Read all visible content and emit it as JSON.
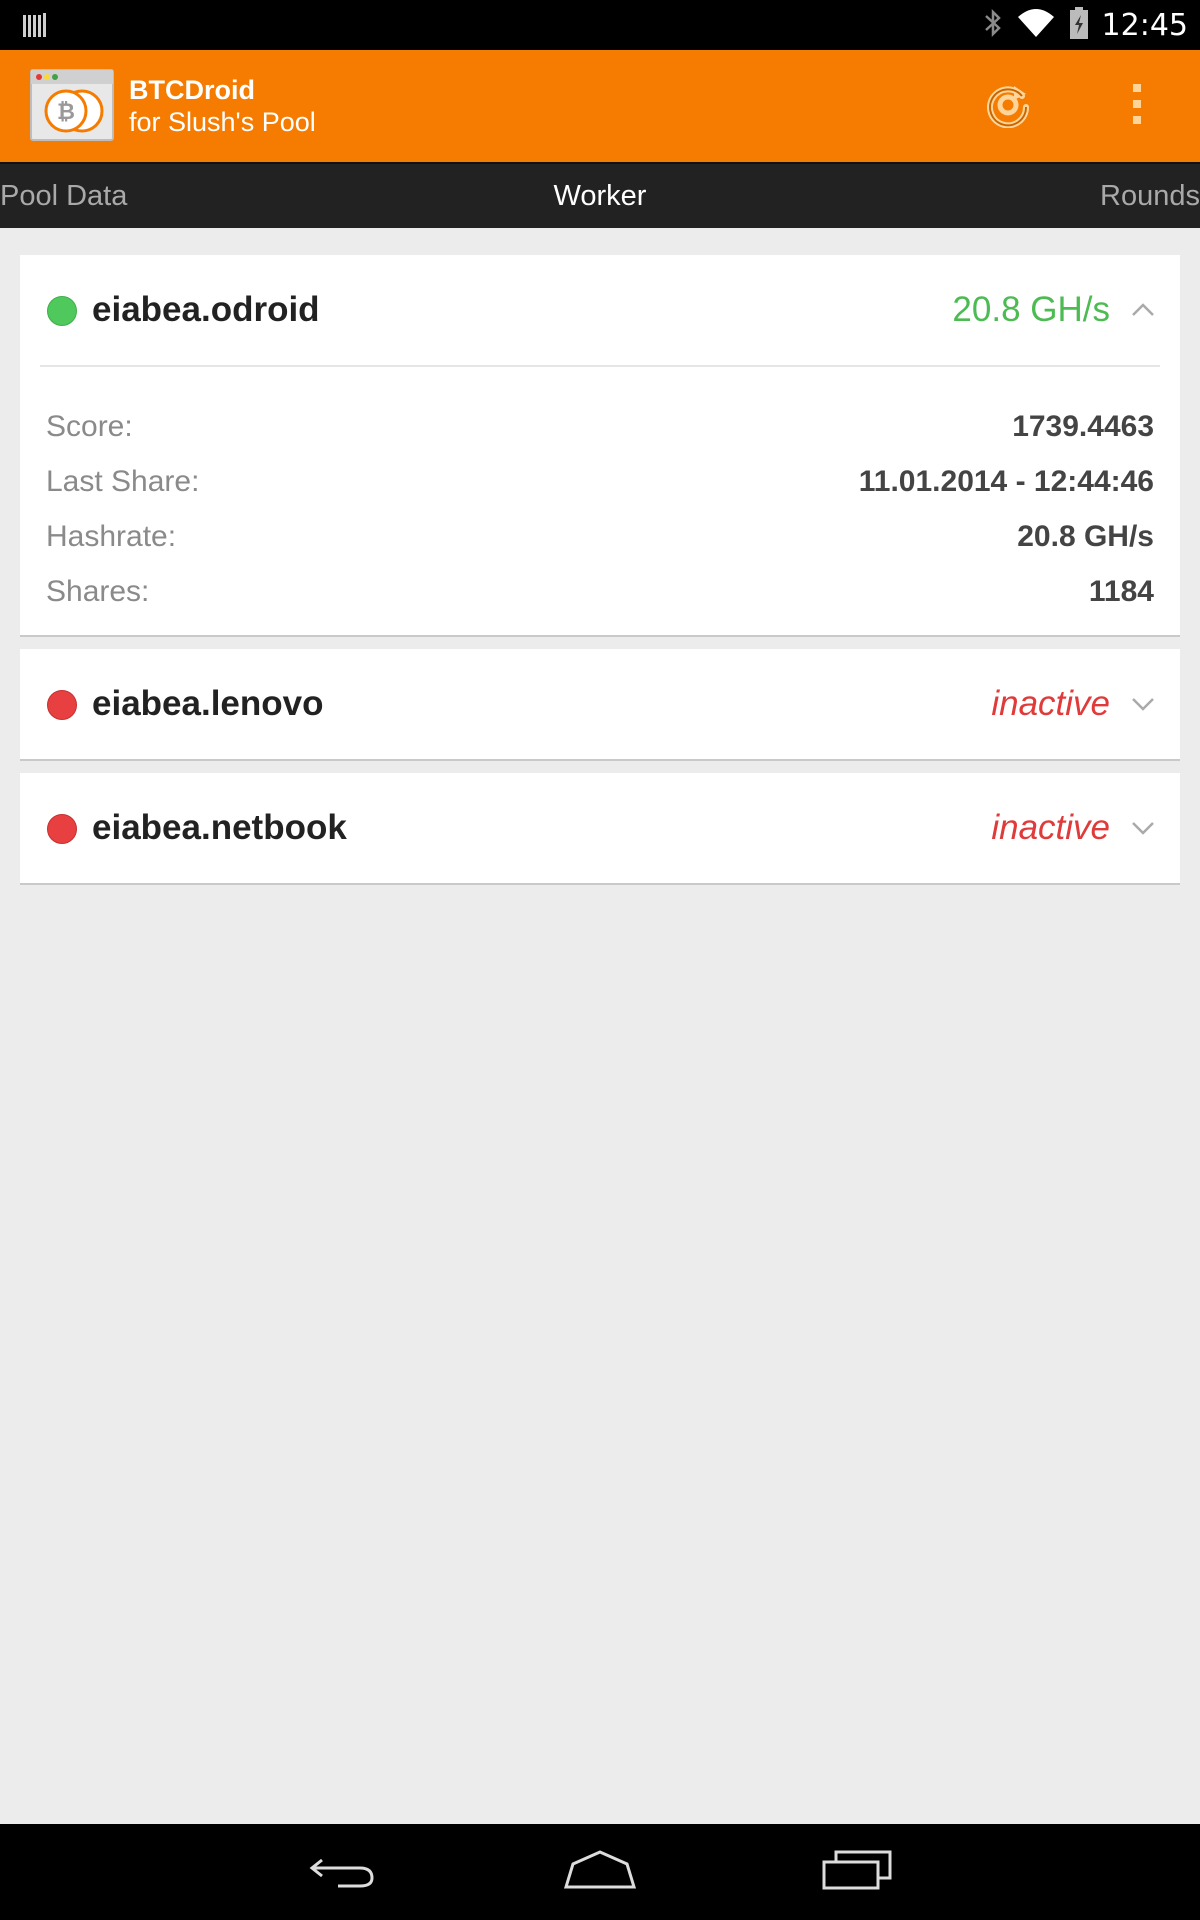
{
  "status_bar": {
    "time": "12:45",
    "icons": [
      "notification-icon",
      "bluetooth-icon",
      "wifi-icon",
      "battery-icon"
    ]
  },
  "app_bar": {
    "title": "BTCDroid",
    "subtitle": "for Slush's Pool",
    "background_color": "#f57c00",
    "actions": [
      "refresh-icon",
      "overflow-menu-icon"
    ]
  },
  "tabs": [
    {
      "label": "Pool Data",
      "active": false
    },
    {
      "label": "Worker",
      "active": true
    },
    {
      "label": "Rounds",
      "active": false
    }
  ],
  "workers": [
    {
      "name": "eiabea.odroid",
      "status": "active",
      "status_color": "#4fc95b",
      "rate_text": "20.8 GH/s",
      "expanded": true,
      "details": [
        {
          "label": "Score:",
          "value": "1739.4463"
        },
        {
          "label": "Last Share:",
          "value": "11.01.2014 - 12:44:46"
        },
        {
          "label": "Hashrate:",
          "value": "20.8 GH/s"
        },
        {
          "label": "Shares:",
          "value": "1184"
        }
      ]
    },
    {
      "name": "eiabea.lenovo",
      "status": "inactive",
      "status_color": "#e84040",
      "rate_text": "inactive",
      "expanded": false
    },
    {
      "name": "eiabea.netbook",
      "status": "inactive",
      "status_color": "#e84040",
      "rate_text": "inactive",
      "expanded": false
    }
  ],
  "nav_bar": {
    "buttons": [
      "back-icon",
      "home-icon",
      "recents-icon"
    ]
  }
}
